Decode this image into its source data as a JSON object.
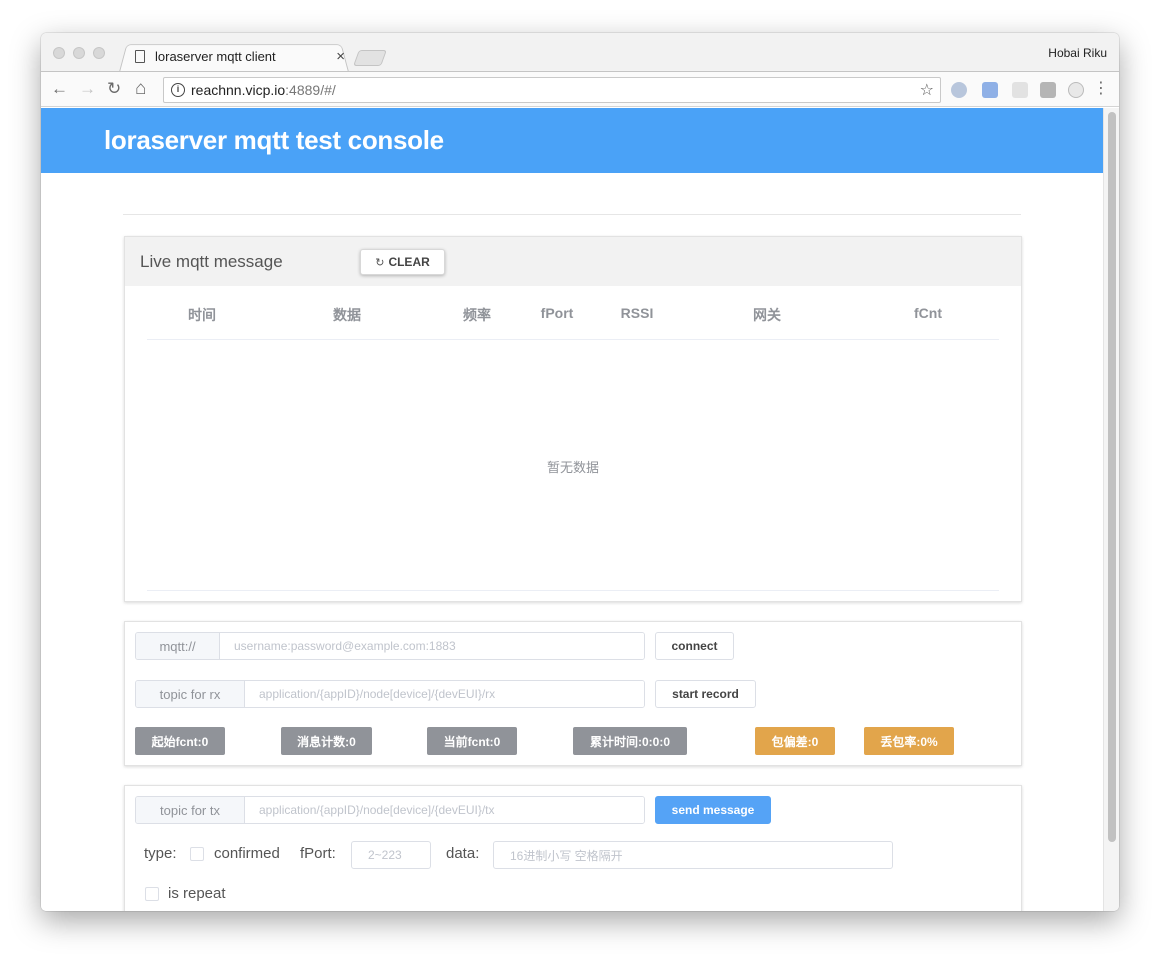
{
  "browser": {
    "tab_title": "loraserver mqtt client",
    "tab_close": "×",
    "profile_name": "Hobai Riku",
    "url_host": "reachnn.vicp.io",
    "url_rest": ":4889/#/",
    "icons": {
      "back": "←",
      "forward": "→",
      "reload": "↻",
      "home": "⌂",
      "star": "☆",
      "menu": "⋮",
      "info": "i"
    }
  },
  "header": {
    "title": "loraserver mqtt test console",
    "color": "#4aa2f7"
  },
  "live": {
    "title": "Live mqtt message",
    "clear_icon": "↻",
    "clear_label": "CLEAR",
    "columns": [
      "时间",
      "数据",
      "频率",
      "fPort",
      "RSSI",
      "网关",
      "fCnt"
    ],
    "empty_text": "暂无数据"
  },
  "connection": {
    "mqtt_prefix": "mqtt://",
    "mqtt_placeholder": "username:password@example.com:1883",
    "connect_label": "connect",
    "rx_prefix": "topic for rx",
    "rx_placeholder": "application/{appID}/node[device]/{devEUI}/rx",
    "record_label": "start record",
    "stats": {
      "start_fcnt": "起始fcnt:0",
      "msg_count": "消息计数:0",
      "current_fcnt": "当前fcnt:0",
      "elapsed": "累计时间:0:0:0",
      "packet_diff": "包偏差:0",
      "loss_rate": "丢包率:0%"
    }
  },
  "send": {
    "tx_prefix": "topic for tx",
    "tx_placeholder": "application/{appID}/node[device]/{devEUI}/tx",
    "send_label": "send message",
    "type_label": "type:",
    "confirmed_label": "confirmed",
    "fport_label": "fPort:",
    "fport_placeholder": "2~223",
    "data_label": "data:",
    "data_placeholder": "16进制小写 空格隔开",
    "repeat_label": "is repeat"
  }
}
